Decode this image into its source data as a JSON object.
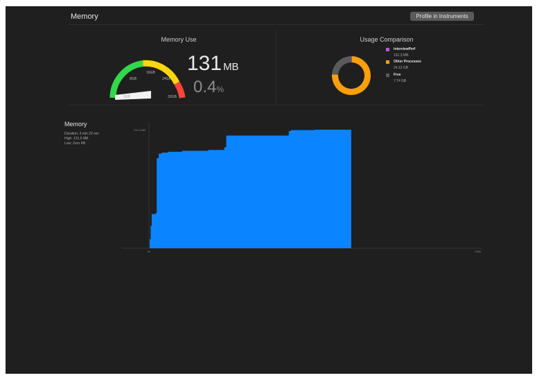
{
  "header": {
    "title": "Memory",
    "profile_button": "Profile in Instruments"
  },
  "memory_use": {
    "title": "Memory Use",
    "value": "131",
    "unit": "MB",
    "percent": "0.4",
    "percent_unit": "%",
    "gauge_labels": [
      "0GB",
      "8GB",
      "16GB",
      "24GB",
      "32GB"
    ],
    "gauge_fraction": 0.004
  },
  "usage_comparison": {
    "title": "Usage Comparison",
    "legend": [
      {
        "name": "interviewPerf",
        "value": "131.3 MB",
        "color": "#b455e0"
      },
      {
        "name": "Other Processes",
        "value": "24.13 GB",
        "color": "#ff9f0a"
      },
      {
        "name": "Free",
        "value": "7.74 GB",
        "color": "#5a5a5a"
      }
    ]
  },
  "memory_graph": {
    "title": "Memory",
    "duration": "Duration: 3 min 22 sec",
    "high": "High: 131.5 MB",
    "low": "Low: Zero KB",
    "y_max_label": "131.5 MB",
    "x_start_label": "0s",
    "x_end_label": "165s"
  },
  "colors": {
    "graph_fill": "#0a84ff",
    "gauge_green": "#32d74b",
    "gauge_yellow": "#ffd60a",
    "gauge_red": "#ff453a"
  },
  "chart_data": [
    {
      "type": "pie",
      "title": "Usage Comparison",
      "categories": [
        "interviewPerf",
        "Other Processes",
        "Free"
      ],
      "values": [
        131.3,
        24709,
        7926
      ],
      "unit": "MB"
    },
    {
      "type": "area",
      "title": "Memory",
      "x": [
        0,
        0.5,
        1,
        3,
        3.5,
        4.5,
        6,
        7,
        9,
        10,
        15,
        16,
        17,
        18,
        28,
        29,
        30,
        34,
        35,
        36,
        37,
        38,
        50,
        52,
        57,
        58,
        59,
        60,
        68,
        69,
        70,
        71,
        82,
        83,
        100
      ],
      "y": [
        10,
        25,
        38,
        39,
        100,
        105,
        106,
        106,
        107,
        107,
        107,
        108,
        108,
        108,
        108,
        109,
        109,
        109,
        109,
        109,
        112,
        125,
        125,
        125,
        125,
        125,
        125,
        125,
        125,
        130,
        131,
        131,
        131.5,
        131.5,
        0
      ],
      "xlim": [
        0,
        165
      ],
      "ylim": [
        0,
        131.5
      ],
      "xlabel": "",
      "ylabel": ""
    }
  ]
}
